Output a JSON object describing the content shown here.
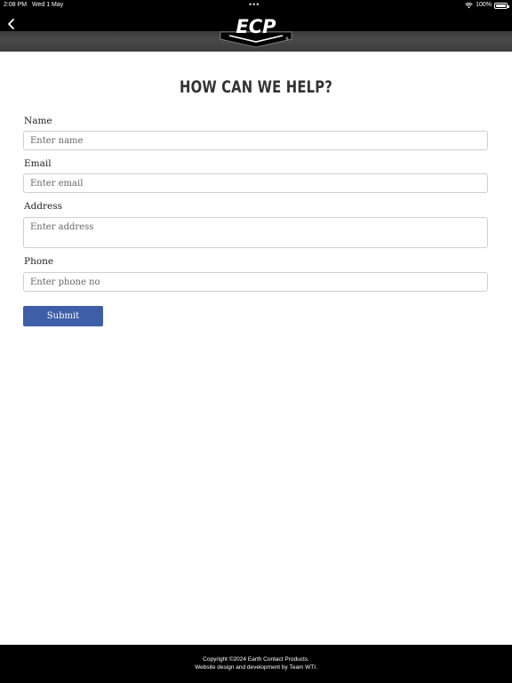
{
  "status_bar": {
    "time": "2:08 PM",
    "date": "Wed 1 May",
    "dots": "•••",
    "battery": "100%"
  },
  "header": {
    "logo_text": "ECP",
    "back_icon": "chevron-left-icon"
  },
  "main": {
    "title": "HOW CAN WE HELP?",
    "fields": [
      {
        "label": "Name",
        "placeholder": "Enter name",
        "value": ""
      },
      {
        "label": "Email",
        "placeholder": "Enter email",
        "value": ""
      },
      {
        "label": "Address",
        "placeholder": "Enter address",
        "value": ""
      },
      {
        "label": "Phone",
        "placeholder": "Enter phone no",
        "value": ""
      }
    ],
    "submit_label": "Submit"
  },
  "footer": {
    "copyright": "Copyright ©2024 Earth Contact Products.",
    "credit": "Website design and development by Team WTI."
  },
  "colors": {
    "header_bg": "#000000",
    "header_band": "#404040",
    "submit_button": "#3e5ea7",
    "footer_bg": "#000000",
    "title_text": "#333333"
  }
}
